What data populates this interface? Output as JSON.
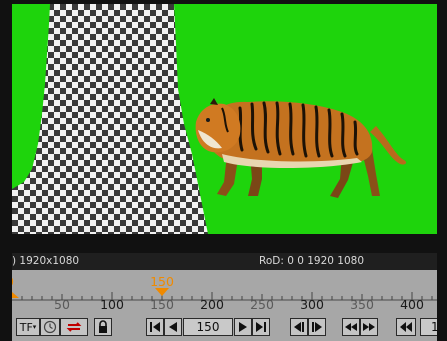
{
  "viewer": {
    "background_color": "#1ed40c",
    "transparency_pattern": "checkerboard",
    "subject": "tiger-image"
  },
  "info_bar": {
    "format_text": ") 1920x1080",
    "rod_text": "RoD: 0 0 1920 1080"
  },
  "timeline": {
    "start_marker_label": "0",
    "current_frame_label": "150",
    "ticks": [
      {
        "label": "50",
        "major": false
      },
      {
        "label": "100",
        "major": true
      },
      {
        "label": "150",
        "major": false
      },
      {
        "label": "200",
        "major": true
      },
      {
        "label": "250",
        "major": false
      },
      {
        "label": "300",
        "major": true
      },
      {
        "label": "350",
        "major": false
      },
      {
        "label": "400",
        "major": true
      }
    ],
    "accent_color": "#f08a00"
  },
  "controls": {
    "tf_label": "TF",
    "frame_value": "150",
    "end_field_value": "1",
    "icons": [
      "clock-icon",
      "loop-icon",
      "lock-icon",
      "first-frame-icon",
      "play-backward-icon",
      "play-forward-icon",
      "last-frame-icon",
      "previous-frame-icon",
      "next-frame-icon",
      "previous-keyframe-icon",
      "next-keyframe-icon",
      "rewind-icon"
    ]
  }
}
